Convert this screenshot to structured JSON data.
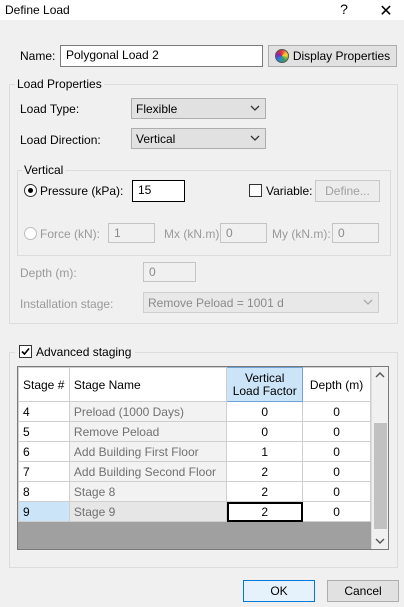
{
  "window": {
    "title": "Define Load",
    "help_glyph": "?",
    "close_glyph": "✕"
  },
  "name": {
    "label": "Name:",
    "value": "Polygonal Load 2",
    "display_button": "Display Properties"
  },
  "load_properties": {
    "legend": "Load Properties",
    "load_type_label": "Load Type:",
    "load_type_value": "Flexible",
    "load_direction_label": "Load Direction:",
    "load_direction_value": "Vertical"
  },
  "vertical": {
    "legend": "Vertical",
    "pressure_label": "Pressure (kPa):",
    "pressure_value": "15",
    "variable_label": "Variable:",
    "define_button": "Define...",
    "force_label": "Force (kN):",
    "force_value": "1",
    "mx_label": "Mx (kN.m):",
    "mx_value": "0",
    "my_label": "My (kN.m):",
    "my_value": "0"
  },
  "depth": {
    "label": "Depth (m):",
    "value": "0"
  },
  "installation": {
    "label": "Installation stage:",
    "value": "Remove Peload = 1001 d"
  },
  "advanced": {
    "label": "Advanced staging",
    "columns": {
      "stage": "Stage #",
      "name": "Stage Name",
      "factor_line1": "Vertical",
      "factor_line2": "Load Factor",
      "depth": "Depth (m)"
    },
    "rows": [
      {
        "stage": "4",
        "name": "Preload (1000 Days)",
        "factor": "0",
        "depth": "0"
      },
      {
        "stage": "5",
        "name": "Remove Peload",
        "factor": "0",
        "depth": "0"
      },
      {
        "stage": "6",
        "name": "Add Building First Floor",
        "factor": "1",
        "depth": "0"
      },
      {
        "stage": "7",
        "name": "Add Building Second Floor",
        "factor": "2",
        "depth": "0"
      },
      {
        "stage": "8",
        "name": "Stage 8",
        "factor": "2",
        "depth": "0"
      },
      {
        "stage": "9",
        "name": "Stage 9",
        "factor": "2",
        "depth": "0"
      }
    ]
  },
  "footer": {
    "ok": "OK",
    "cancel": "Cancel"
  }
}
